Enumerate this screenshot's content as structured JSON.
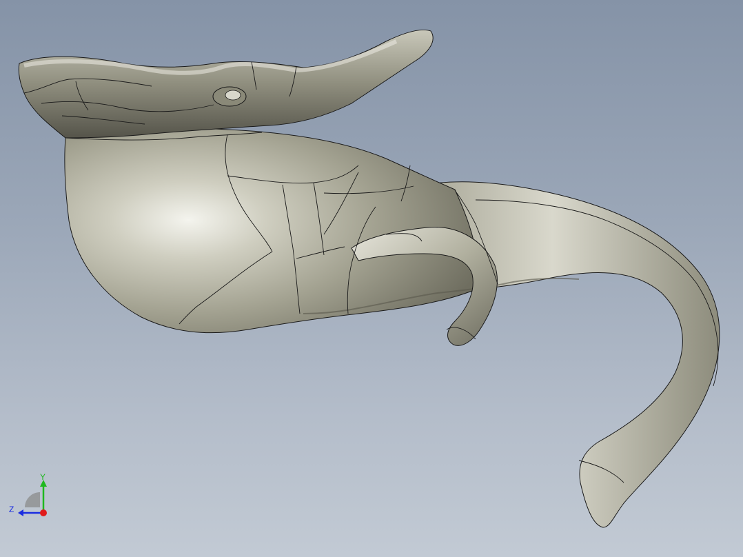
{
  "viewport": {
    "background_top": "#8593a7",
    "background_bottom": "#c2cad4"
  },
  "model": {
    "surface_color": "#b9b8a6",
    "edge_color": "#1a1a1a",
    "icon": "elephant-head-3d-model"
  },
  "triad": {
    "x_color": "#e01b1b",
    "y_color": "#1fb81f",
    "z_color": "#1b2de0",
    "y_label": "Y",
    "z_label": "Z"
  }
}
